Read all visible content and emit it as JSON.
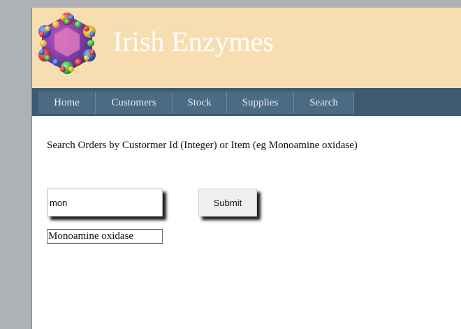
{
  "header": {
    "title": "Irish Enzymes"
  },
  "nav": {
    "items": [
      "Home",
      "Customers",
      "Stock",
      "Supplies",
      "Search"
    ]
  },
  "search": {
    "instructions": "Search Orders by Custormer Id (Integer) or Item (eg Monoamine oxidase)",
    "input_value": "mon",
    "submit_label": "Submit",
    "suggestion": "Monoamine oxidase"
  },
  "colors": {
    "header_bg": "#f7deb0",
    "nav_bg": "#3f5b73",
    "nav_item_bg": "#4b6a84",
    "page_bg": "#ffffff",
    "outer_bg": "#aeb1b6"
  },
  "icons": {
    "logo": "enzyme-molecule-logo"
  }
}
